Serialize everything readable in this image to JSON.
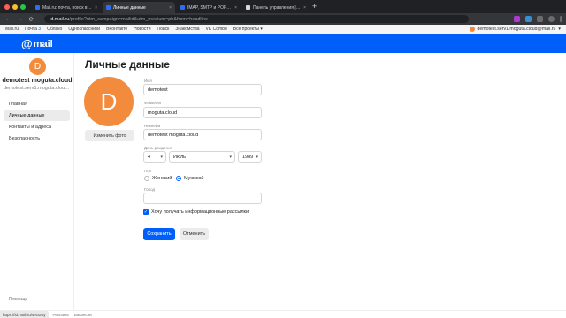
{
  "browser": {
    "tabs": [
      {
        "title": "Mail.ru: почта, поиск в интер...",
        "favicon_color": "#2f6cf0",
        "active": false
      },
      {
        "title": "Личные данные",
        "favicon_color": "#2f6cf0",
        "active": true
      },
      {
        "title": "IMAP, SMTP и POP3 Mail.ru —",
        "favicon_color": "#2f6cf0",
        "active": false
      },
      {
        "title": "Панель управления | Mogut...",
        "favicon_color": "#d9d9d9",
        "active": false
      }
    ],
    "tab_close_glyph": "×",
    "new_tab_glyph": "+",
    "nav": {
      "back": "←",
      "forward": "→",
      "reload": "⟳"
    },
    "url_host": "id.mail.ru",
    "url_path": "/profile?utm_campaign=mailid&utm_medium=ph&from=headline"
  },
  "portal_nav": {
    "links": [
      "Mail.ru",
      "Почта",
      "Облако",
      "Одноклассники",
      "ВКонтакте",
      "Новости",
      "Поиск",
      "Знакомства",
      "VK Combo",
      "Все проекты"
    ],
    "mail_badge": "3",
    "user_email": "demotest.serv1.moguta.cloud@mail.ru"
  },
  "brand": {
    "logo_text": "mail",
    "logo_at": "@",
    "color": "#005ff9"
  },
  "sidebar": {
    "avatar_letter": "D",
    "name": "demotest moguta.cloud",
    "email": "demotest.serv1.moguta.cloud...",
    "items": [
      {
        "label": "Главная",
        "active": false
      },
      {
        "label": "Личные данные",
        "active": true
      },
      {
        "label": "Контакты и адреса",
        "active": false
      },
      {
        "label": "Безопасность",
        "active": false
      }
    ],
    "help": "Помощь"
  },
  "main": {
    "title": "Личные данные",
    "avatar_letter": "D",
    "change_photo": "Изменить фото",
    "fields": {
      "first_name": {
        "label": "Имя",
        "value": "demotest"
      },
      "last_name": {
        "label": "Фамилия",
        "value": "moguta.cloud"
      },
      "nickname": {
        "label": "Никнейм",
        "value": "demotest moguta.cloud"
      },
      "birthday": {
        "label": "День рождения",
        "day": "4",
        "month": "Июль",
        "year": "1989"
      },
      "gender": {
        "label": "Пол",
        "female": "Женский",
        "male": "Мужской",
        "selected": "male"
      },
      "city": {
        "label": "Город",
        "value": ""
      }
    },
    "newsletter": {
      "label": "Хочу получать информационные рассылки",
      "checked": true
    },
    "save": "Сохранить",
    "cancel": "Отменить"
  },
  "statusbar": {
    "url": "https://id.mail.ru/security",
    "links": [
      "Реклама",
      "Вакансии"
    ]
  }
}
